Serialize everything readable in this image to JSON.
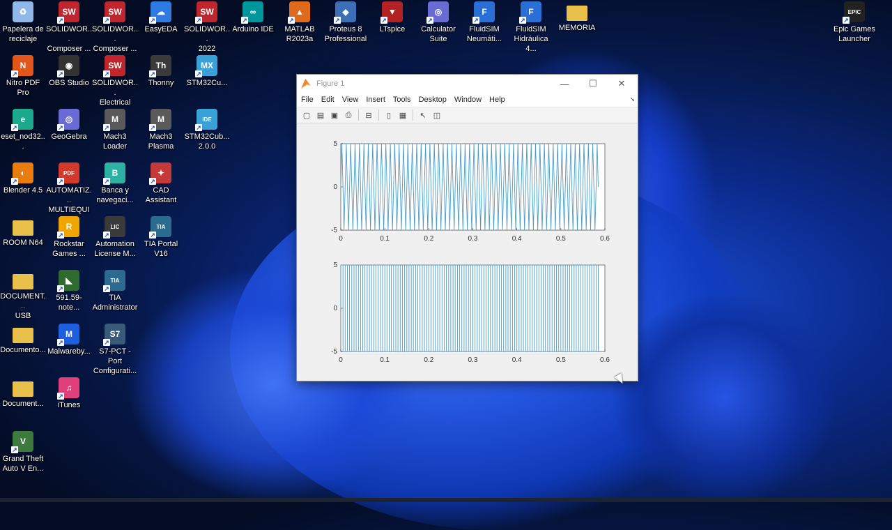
{
  "desktop_icons": [
    {
      "label": "Papelera de\nreciclaje",
      "icon": "recycle-bin-icon",
      "color": "#8fb7e8",
      "glyph": "♻"
    },
    {
      "label": "SOLIDWOR...\nComposer ...",
      "icon": "solidworks-composer-icon",
      "color": "#c0262d",
      "glyph": "SW"
    },
    {
      "label": "SOLIDWOR...\nComposer ...",
      "icon": "solidworks-composer-icon",
      "color": "#c0262d",
      "glyph": "SW"
    },
    {
      "label": "EasyEDA",
      "icon": "easyeda-icon",
      "color": "#2d7be0",
      "glyph": "☁"
    },
    {
      "label": "SOLIDWOR...\n2022",
      "icon": "solidworks-icon",
      "color": "#c0262d",
      "glyph": "SW"
    },
    {
      "label": "Arduino IDE",
      "icon": "arduino-icon",
      "color": "#00979c",
      "glyph": "∞"
    },
    {
      "label": "MATLAB\nR2023a",
      "icon": "matlab-icon",
      "color": "#e06a1b",
      "glyph": "▲"
    },
    {
      "label": "Proteus 8\nProfessional",
      "icon": "proteus-icon",
      "color": "#3c6fb7",
      "glyph": "◆"
    },
    {
      "label": "LTspice",
      "icon": "ltspice-icon",
      "color": "#b22222",
      "glyph": "▼"
    },
    {
      "label": "Calculator\nSuite",
      "icon": "geogebra-calculator-icon",
      "color": "#6b6bd6",
      "glyph": "◎"
    },
    {
      "label": "FluidSIM\nNeumáti...",
      "icon": "fluidsim-icon",
      "color": "#2a6fd6",
      "glyph": "F"
    },
    {
      "label": "FluidSIM\nHidráulica 4...",
      "icon": "fluidsim-hydraulics-icon",
      "color": "#2a6fd6",
      "glyph": "F"
    },
    {
      "label": "MEMORIA",
      "icon": "folder-icon",
      "color": "#e8c04a",
      "glyph": ""
    },
    {
      "label": "Epic Games\nLauncher",
      "icon": "epic-games-icon",
      "color": "#222222",
      "glyph": "EPIC"
    },
    {
      "label": "Nitro PDF Pro",
      "icon": "nitro-pdf-icon",
      "color": "#e2561b",
      "glyph": "N"
    },
    {
      "label": "OBS Studio",
      "icon": "obs-icon",
      "color": "#333333",
      "glyph": "◉"
    },
    {
      "label": "SOLIDWOR...\nElectrical",
      "icon": "solidworks-electrical-icon",
      "color": "#c0262d",
      "glyph": "SW"
    },
    {
      "label": "Thonny",
      "icon": "thonny-icon",
      "color": "#3a3a3a",
      "glyph": "Th"
    },
    {
      "label": "STM32Cu...",
      "icon": "stm32cubemx-icon",
      "color": "#3aa0d8",
      "glyph": "MX"
    },
    {
      "label": "eset_nod32...",
      "icon": "eset-icon",
      "color": "#1aa98c",
      "glyph": "e"
    },
    {
      "label": "GeoGebra",
      "icon": "geogebra-icon",
      "color": "#6b6bd6",
      "glyph": "◎"
    },
    {
      "label": "Mach3\nLoader",
      "icon": "mach3-loader-icon",
      "color": "#5a5a5a",
      "glyph": "M"
    },
    {
      "label": "Mach3\nPlasma",
      "icon": "mach3-plasma-icon",
      "color": "#5a5a5a",
      "glyph": "M"
    },
    {
      "label": "STM32Cub...\n2.0.0",
      "icon": "stm32cubeide-icon",
      "color": "#3aa0d8",
      "glyph": "IDE"
    },
    {
      "label": "Blender 4.5",
      "icon": "blender-icon",
      "color": "#e87d0d",
      "glyph": "◐"
    },
    {
      "label": "AUTOMATIZ...\nMULTIEQUIP...",
      "icon": "pdf-file-icon",
      "color": "#d33a2c",
      "glyph": "PDF"
    },
    {
      "label": "Banca y\nnavegaci...",
      "icon": "banking-browser-icon",
      "color": "#2eb1a5",
      "glyph": "B"
    },
    {
      "label": "CAD\nAssistant",
      "icon": "cad-assistant-icon",
      "color": "#c43a3a",
      "glyph": "✦"
    },
    {
      "label": "ROOM N64",
      "icon": "folder-icon",
      "color": "#e8c04a",
      "glyph": ""
    },
    {
      "label": "Rockstar\nGames ...",
      "icon": "rockstar-icon",
      "color": "#f0a500",
      "glyph": "R"
    },
    {
      "label": "Automation\nLicense M...",
      "icon": "automation-license-icon",
      "color": "#3a3a3a",
      "glyph": "LIC"
    },
    {
      "label": "TIA Portal\nV16",
      "icon": "tia-portal-icon",
      "color": "#2b6b8f",
      "glyph": "TIA"
    },
    {
      "label": "DOCUMENT...\nUSB",
      "icon": "folder-icon",
      "color": "#e8c04a",
      "glyph": ""
    },
    {
      "label": "591.59-note...",
      "icon": "nvidia-icon",
      "color": "#2f6b2f",
      "glyph": "◣"
    },
    {
      "label": "TIA\nAdministrator",
      "icon": "tia-admin-icon",
      "color": "#2b6b8f",
      "glyph": "TIA"
    },
    {
      "label": "Documento...",
      "icon": "folder-icon",
      "color": "#e8c04a",
      "glyph": ""
    },
    {
      "label": "Malwareby...",
      "icon": "malwarebytes-icon",
      "color": "#1e5fe0",
      "glyph": "M"
    },
    {
      "label": "S7-PCT - Port\nConfigurati...",
      "icon": "s7-pct-icon",
      "color": "#3a5a7a",
      "glyph": "S7"
    },
    {
      "label": "Document...",
      "icon": "folder-icon",
      "color": "#e8c04a",
      "glyph": ""
    },
    {
      "label": "iTunes",
      "icon": "itunes-icon",
      "color": "#e0417a",
      "glyph": "♫"
    },
    {
      "label": "Grand Theft\nAuto V En...",
      "icon": "gta-v-icon",
      "color": "#3d7a3d",
      "glyph": "V"
    }
  ],
  "window": {
    "title": "Figure 1",
    "minimize": "—",
    "maximize": "☐",
    "close": "✕",
    "menu": [
      "File",
      "Edit",
      "View",
      "Insert",
      "Tools",
      "Desktop",
      "Window",
      "Help"
    ],
    "dock_arrow": "➘",
    "toolbar": [
      {
        "name": "new-figure-icon",
        "glyph": "▢"
      },
      {
        "name": "open-file-icon",
        "glyph": "▤"
      },
      {
        "name": "save-icon",
        "glyph": "▣"
      },
      {
        "name": "print-icon",
        "glyph": "⎙"
      },
      {
        "sep": true
      },
      {
        "name": "link-plot-icon",
        "glyph": "⊟"
      },
      {
        "sep": true
      },
      {
        "name": "colorbar-icon",
        "glyph": "▯"
      },
      {
        "name": "legend-icon",
        "glyph": "▦"
      },
      {
        "sep": true
      },
      {
        "name": "pointer-icon",
        "glyph": "↖"
      },
      {
        "name": "property-inspector-icon",
        "glyph": "◫"
      }
    ]
  },
  "chart_data": [
    {
      "type": "line",
      "title": "",
      "xlabel": "",
      "ylabel": "",
      "xlim": [
        0,
        0.6
      ],
      "ylim": [
        -5,
        5
      ],
      "xticks": [
        "0",
        "0.1",
        "0.2",
        "0.3",
        "0.4",
        "0.5",
        "0.6"
      ],
      "yticks": [
        "5",
        "0",
        "-5"
      ],
      "series": [
        {
          "waveform": "triangle",
          "amplitude": 5,
          "period": 0.01,
          "x_end": 0.585,
          "color": "#4a9bc8"
        }
      ]
    },
    {
      "type": "line",
      "title": "",
      "xlabel": "",
      "ylabel": "",
      "xlim": [
        0,
        0.6
      ],
      "ylim": [
        -5,
        5
      ],
      "xticks": [
        "0",
        "0.1",
        "0.2",
        "0.3",
        "0.4",
        "0.5",
        "0.6"
      ],
      "yticks": [
        "5",
        "0",
        "-5"
      ],
      "series": [
        {
          "waveform": "square",
          "amplitude": 5,
          "period": 0.01,
          "x_end": 0.585,
          "color": "#4a9bc8"
        }
      ]
    }
  ]
}
